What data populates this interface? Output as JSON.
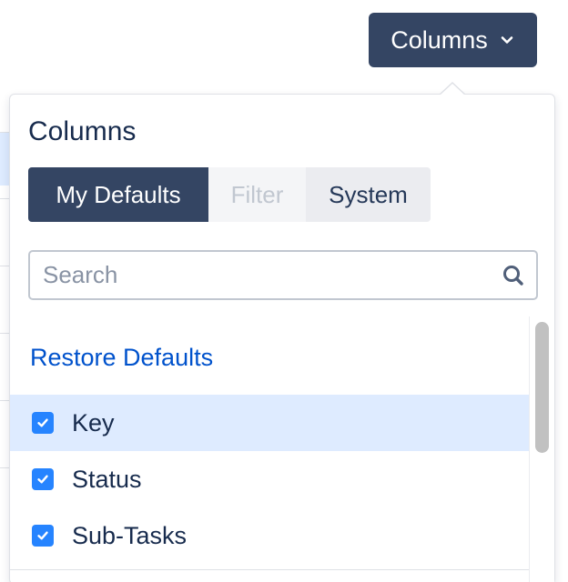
{
  "trigger": {
    "label": "Columns",
    "icon": "chevron-down-icon",
    "background": "#344563"
  },
  "popover": {
    "title": "Columns",
    "tabs": [
      {
        "label": "My Defaults",
        "state": "active"
      },
      {
        "label": "Filter",
        "state": "disabled"
      },
      {
        "label": "System",
        "state": "normal"
      }
    ],
    "search": {
      "placeholder": "Search",
      "value": "",
      "icon": "search-icon"
    },
    "restore_label": "Restore Defaults",
    "items": [
      {
        "label": "Key",
        "checked": true,
        "highlighted": true
      },
      {
        "label": "Status",
        "checked": true,
        "highlighted": false
      },
      {
        "label": "Sub-Tasks",
        "checked": true,
        "highlighted": false
      }
    ]
  },
  "colors": {
    "accent": "#344563",
    "link": "#0052cc",
    "checkbox": "#2684ff",
    "highlight": "#deebff"
  }
}
